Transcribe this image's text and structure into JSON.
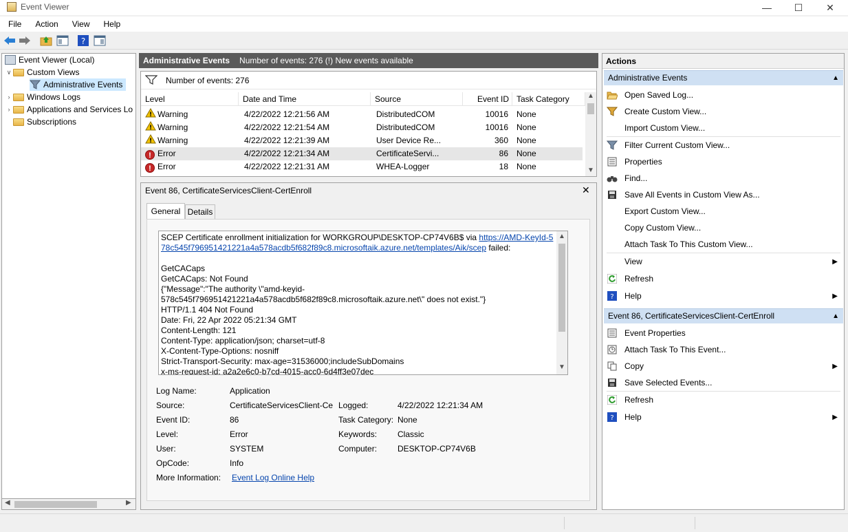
{
  "window": {
    "title": "Event Viewer"
  },
  "menu": [
    "File",
    "Action",
    "View",
    "Help"
  ],
  "tree": {
    "root": "Event Viewer (Local)",
    "custom_views": "Custom Views",
    "admin_events": "Administrative Events",
    "windows_logs": "Windows Logs",
    "apps_services": "Applications and Services Lo",
    "subscriptions": "Subscriptions"
  },
  "center": {
    "header_title": "Administrative Events",
    "header_info": "Number of events: 276 (!) New events available",
    "count_label": "Number of events: 276",
    "columns": [
      "Level",
      "Date and Time",
      "Source",
      "Event ID",
      "Task Category"
    ],
    "rows": [
      {
        "level": "Warning",
        "date": "4/22/2022 12:21:56 AM",
        "source": "DistributedCOM",
        "id": "10016",
        "category": "None"
      },
      {
        "level": "Warning",
        "date": "4/22/2022 12:21:54 AM",
        "source": "DistributedCOM",
        "id": "10016",
        "category": "None"
      },
      {
        "level": "Warning",
        "date": "4/22/2022 12:21:39 AM",
        "source": "User Device Re...",
        "id": "360",
        "category": "None"
      },
      {
        "level": "Error",
        "date": "4/22/2022 12:21:34 AM",
        "source": "CertificateServi...",
        "id": "86",
        "category": "None"
      },
      {
        "level": "Error",
        "date": "4/22/2022 12:21:31 AM",
        "source": "WHEA-Logger",
        "id": "18",
        "category": "None"
      }
    ]
  },
  "detail": {
    "title": "Event 86, CertificateServicesClient-CertEnroll",
    "tabs": [
      "General",
      "Details"
    ],
    "message_prefix": "SCEP Certificate enrollment initialization for WORKGROUP\\DESKTOP-CP74V6B$ via ",
    "message_link": "https://AMD-KeyId-578c545f796951421221a4a578acdb5f682f89c8.microsoftaik.azure.net/templates/Aik/scep",
    "message_suffix": " failed:",
    "message_lines": [
      "GetCACaps",
      "GetCACaps: Not Found",
      "{\"Message\":\"The authority \\\"amd-keyid-578c545f796951421221a4a578acdb5f682f89c8.microsoftaik.azure.net\\\" does not exist.\"}",
      "HTTP/1.1 404 Not Found",
      "Date: Fri, 22 Apr 2022 05:21:34 GMT",
      "Content-Length: 121",
      "Content-Type: application/json; charset=utf-8",
      "X-Content-Type-Options: nosniff",
      "Strict-Transport-Security: max-age=31536000;includeSubDomains",
      "x-ms-request-id: a2a2e6c0-b7cd-4015-acc0-6d4ff3e07dec"
    ],
    "fields": {
      "log_name_label": "Log Name:",
      "log_name": "Application",
      "source_label": "Source:",
      "source": "CertificateServicesClient-Cer",
      "logged_label": "Logged:",
      "logged": "4/22/2022 12:21:34 AM",
      "event_id_label": "Event ID:",
      "event_id": "86",
      "task_category_label": "Task Category:",
      "task_category": "None",
      "level_label": "Level:",
      "level": "Error",
      "keywords_label": "Keywords:",
      "keywords": "Classic",
      "user_label": "User:",
      "user": "SYSTEM",
      "computer_label": "Computer:",
      "computer": "DESKTOP-CP74V6B",
      "opcode_label": "OpCode:",
      "opcode": "Info",
      "more_info_label": "More Information:",
      "more_info_link": "Event Log Online Help"
    }
  },
  "actions": {
    "title": "Actions",
    "section1": "Administrative Events",
    "items1": [
      {
        "label": "Open Saved Log...",
        "icon": "folder-open-icon"
      },
      {
        "label": "Create Custom View...",
        "icon": "filter-icon"
      },
      {
        "label": "Import Custom View...",
        "icon": "none"
      },
      {
        "label": "Filter Current Custom View...",
        "icon": "filter-icon"
      },
      {
        "label": "Properties",
        "icon": "properties-icon"
      },
      {
        "label": "Find...",
        "icon": "binoculars-icon"
      },
      {
        "label": "Save All Events in Custom View As...",
        "icon": "save-icon"
      },
      {
        "label": "Export Custom View...",
        "icon": "none"
      },
      {
        "label": "Copy Custom View...",
        "icon": "none"
      },
      {
        "label": "Attach Task To This Custom View...",
        "icon": "none"
      },
      {
        "label": "View",
        "icon": "none"
      },
      {
        "label": "Refresh",
        "icon": "refresh-icon"
      },
      {
        "label": "Help",
        "icon": "help-icon"
      }
    ],
    "section2": "Event 86, CertificateServicesClient-CertEnroll",
    "items2": [
      {
        "label": "Event Properties",
        "icon": "properties-icon"
      },
      {
        "label": "Attach Task To This Event...",
        "icon": "task-icon"
      },
      {
        "label": "Copy",
        "icon": "copy-icon"
      },
      {
        "label": "Save Selected Events...",
        "icon": "save-icon"
      },
      {
        "label": "Refresh",
        "icon": "refresh-icon"
      },
      {
        "label": "Help",
        "icon": "help-icon"
      }
    ]
  },
  "colors": {
    "header_bg": "#5a5a5a",
    "section_bg": "#cfe0f3",
    "link": "#0645ad",
    "error": "#c62828",
    "warning": "#f2c200"
  }
}
